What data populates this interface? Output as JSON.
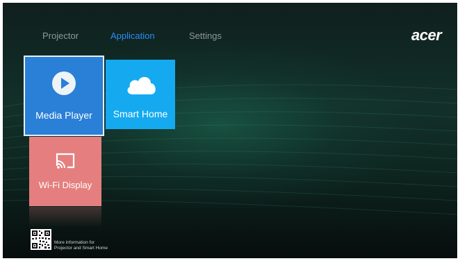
{
  "nav": {
    "tabs": [
      {
        "label": "Projector",
        "active": false
      },
      {
        "label": "Application",
        "active": true
      },
      {
        "label": "Settings",
        "active": false
      }
    ]
  },
  "brand": {
    "logo": "acer"
  },
  "tiles": [
    {
      "label": "Media Player",
      "icon": "play-circle-icon",
      "color": "#2a7fd6",
      "selected": true
    },
    {
      "label": "Smart Home",
      "icon": "cloud-icon",
      "color": "#15aaf0",
      "selected": false
    },
    {
      "label": "Wi-Fi Display",
      "icon": "screen-cast-icon",
      "color": "#e57f7f",
      "selected": false
    }
  ],
  "footer": {
    "info_line1": "More information for",
    "info_line2": "Projector and Smart Home"
  },
  "colors": {
    "accent": "#2a8df6",
    "tab_inactive": "#8e9a97"
  }
}
